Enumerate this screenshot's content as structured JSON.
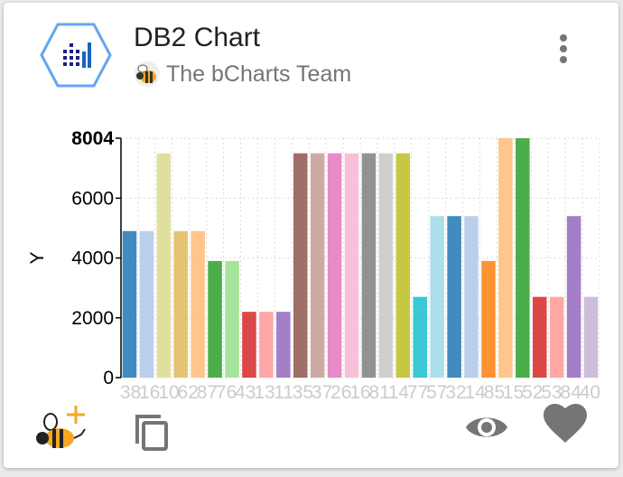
{
  "card": {
    "title": "DB2 Chart",
    "author": "The bCharts Team"
  },
  "icons": {
    "logo": "bar-chart-hexagon-icon",
    "author_avatar": "bee-icon",
    "menu": "more-vert-icon",
    "add": "bee-add-icon",
    "copy": "copy-icon",
    "view": "eye-icon",
    "like": "heart-icon"
  },
  "colors": {
    "accent": "#64a6f0",
    "icon_gray": "#757575",
    "bee_orange": "#f5a623"
  },
  "chart_data": {
    "type": "bar",
    "title": "",
    "xlabel": "",
    "ylabel": "Y",
    "ylim": [
      0,
      8004
    ],
    "yticks": [
      "0",
      "2000",
      "4000",
      "6000",
      "8004"
    ],
    "categories": [
      "38",
      "16",
      "10",
      "62",
      "87",
      "76",
      "43",
      "13",
      "11",
      "35",
      "37",
      "26",
      "16",
      "81",
      "14",
      "77",
      "57",
      "32",
      "14",
      "85",
      "15",
      "52",
      "53",
      "84",
      "40"
    ],
    "values": [
      4900,
      4900,
      4900,
      4900,
      3900,
      3900,
      2200,
      2200,
      2200,
      7500,
      7500,
      7500,
      7500,
      7500,
      7500,
      7500,
      2700,
      5400,
      5400,
      5400,
      3900,
      8004,
      2700,
      2700,
      5400,
      2700
    ],
    "bars": [
      {
        "category": "38",
        "value": 4900,
        "color": "#1f77b4"
      },
      {
        "category": "16",
        "value": 4900,
        "color": "#aec7e8"
      },
      {
        "category": "10",
        "value": 7500,
        "color": "#dbdb8d"
      },
      {
        "category": "10",
        "value": 4900,
        "color": "#e2b85b"
      },
      {
        "category": "62",
        "value": 4900,
        "color": "#ffbb78"
      },
      {
        "category": "87",
        "value": 3900,
        "color": "#2ca02c"
      },
      {
        "category": "76",
        "value": 3900,
        "color": "#98df8a"
      },
      {
        "category": "43",
        "value": 2200,
        "color": "#d62728"
      },
      {
        "category": "13",
        "value": 2200,
        "color": "#ff9896"
      },
      {
        "category": "11",
        "value": 2200,
        "color": "#9467bd"
      },
      {
        "category": "35",
        "value": 7500,
        "color": "#8c564b"
      },
      {
        "category": "37",
        "value": 7500,
        "color": "#c49c94"
      },
      {
        "category": "26",
        "value": 7500,
        "color": "#e377c2"
      },
      {
        "category": "16",
        "value": 7500,
        "color": "#f7b6d2"
      },
      {
        "category": "81",
        "value": 7500,
        "color": "#7f7f7f"
      },
      {
        "category": "81",
        "value": 7500,
        "color": "#c7c7c7"
      },
      {
        "category": "14",
        "value": 7500,
        "color": "#bcbd22"
      },
      {
        "category": "77",
        "value": 2700,
        "color": "#17becf"
      },
      {
        "category": "57",
        "value": 5400,
        "color": "#9edae5"
      },
      {
        "category": "32",
        "value": 5400,
        "color": "#1f77b4"
      },
      {
        "category": "14",
        "value": 5400,
        "color": "#aec7e8"
      },
      {
        "category": "85",
        "value": 3900,
        "color": "#ff7f0e"
      },
      {
        "category": "15",
        "value": 8004,
        "color": "#ffbb78"
      },
      {
        "category": "52",
        "value": 8004,
        "color": "#2ca02c"
      },
      {
        "category": "52",
        "value": 2700,
        "color": "#d62728"
      },
      {
        "category": "53",
        "value": 2700,
        "color": "#ff9896"
      },
      {
        "category": "84",
        "value": 5400,
        "color": "#9467bd"
      },
      {
        "category": "40",
        "value": 2700,
        "color": "#c5b0d5"
      }
    ]
  }
}
